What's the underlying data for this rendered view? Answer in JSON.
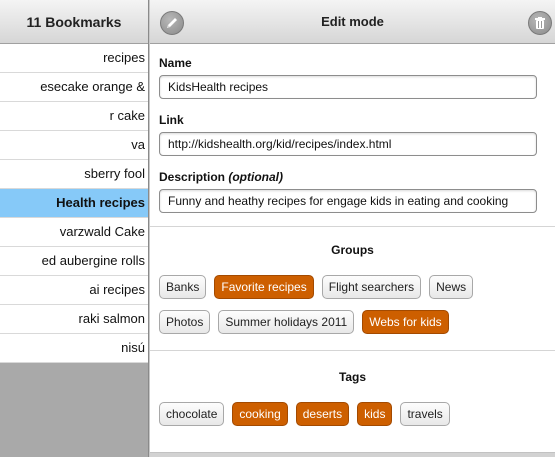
{
  "left": {
    "title": "11 Bookmarks",
    "items": [
      {
        "label": "recipes",
        "selected": false
      },
      {
        "label": "esecake orange &",
        "selected": false
      },
      {
        "label": "r cake",
        "selected": false
      },
      {
        "label": "va",
        "selected": false
      },
      {
        "label": "sberry fool",
        "selected": false
      },
      {
        "label": "Health recipes",
        "selected": true
      },
      {
        "label": "varzwald Cake",
        "selected": false
      },
      {
        "label": "ed aubergine rolls",
        "selected": false
      },
      {
        "label": "ai recipes",
        "selected": false
      },
      {
        "label": "raki salmon",
        "selected": false
      },
      {
        "label": "nisú",
        "selected": false
      }
    ]
  },
  "header": {
    "title": "Edit mode",
    "left_icon": "pencil-icon",
    "right_icon": "trash-icon"
  },
  "form": {
    "name_label": "Name",
    "name_value": "KidsHealth recipes",
    "link_label": "Link",
    "link_value": "http://kidshealth.org/kid/recipes/index.html",
    "description_label": "Description",
    "description_optional": "(optional)",
    "description_value": "Funny and heathy recipes for engage kids in eating and cooking"
  },
  "groups": {
    "title": "Groups",
    "row1": [
      {
        "label": "Banks",
        "active": false
      },
      {
        "label": "Favorite recipes",
        "active": true
      },
      {
        "label": "Flight searchers",
        "active": false
      },
      {
        "label": "News",
        "active": false
      }
    ],
    "row2": [
      {
        "label": "Photos",
        "active": false
      },
      {
        "label": "Summer holidays 2011",
        "active": false
      },
      {
        "label": "Webs for kids",
        "active": true
      }
    ]
  },
  "tags": {
    "title": "Tags",
    "items": [
      {
        "label": "chocolate",
        "active": false
      },
      {
        "label": "cooking",
        "active": true
      },
      {
        "label": "deserts",
        "active": true
      },
      {
        "label": "kids",
        "active": true
      },
      {
        "label": "travels",
        "active": false
      }
    ]
  },
  "colors": {
    "active_chip": "#cd5f00",
    "selected_row": "#86c9f8"
  }
}
